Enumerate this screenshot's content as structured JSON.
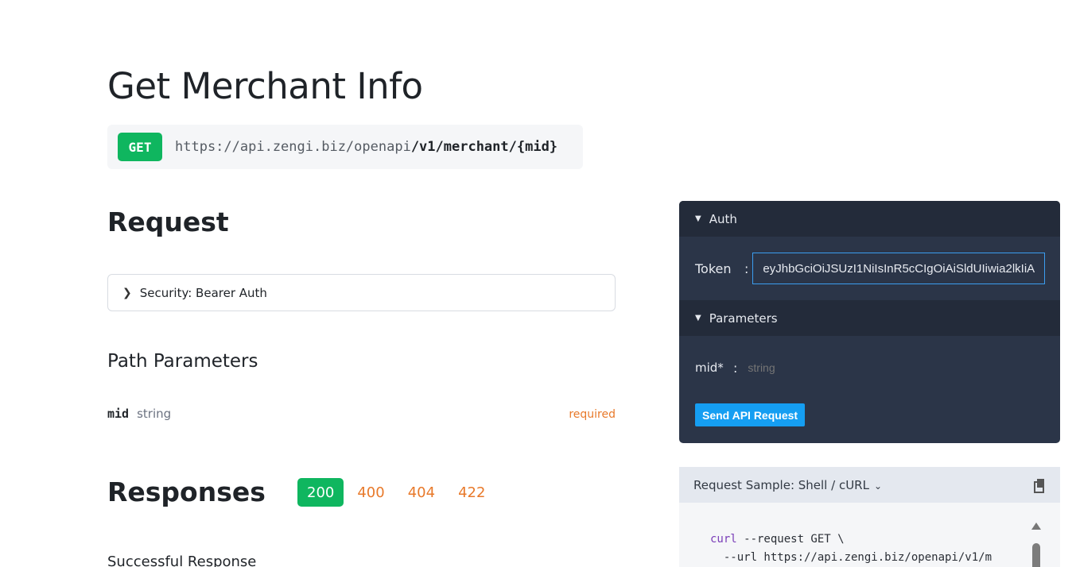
{
  "page": {
    "title": "Get Merchant Info"
  },
  "endpoint": {
    "method": "GET",
    "base_url": "https://api.zengi.biz/openapi",
    "path": "/v1/merchant/{mid}"
  },
  "request": {
    "title": "Request",
    "security_label": "Security: Bearer Auth",
    "path_params_title": "Path Parameters",
    "params": [
      {
        "name": "mid",
        "type": "string",
        "required": "required"
      }
    ]
  },
  "responses": {
    "title": "Responses",
    "codes": [
      "200",
      "400",
      "404",
      "422"
    ],
    "active_code": "200",
    "description": "Successful Response"
  },
  "try_panel": {
    "auth_label": "Auth",
    "token_label": "Token",
    "colon": ":",
    "token_value": "eyJhbGciOiJSUzI1NiIsInR5cCIgOiAiSldUIiwia2lkIiA",
    "parameters_label": "Parameters",
    "mid_label": "mid*",
    "mid_placeholder": "string",
    "send_label": "Send API Request"
  },
  "sample": {
    "header_label": "Request Sample: Shell / cURL",
    "code_line1_kw": "curl",
    "code_line1_rest": " --request GET \\",
    "code_line2": "  --url https://api.zengi.biz/openapi/v1/m"
  },
  "colors": {
    "get_badge": "#0fb65f",
    "required": "#e8792a",
    "panel_bg": "#2b3548",
    "send_button": "#159ef2"
  }
}
